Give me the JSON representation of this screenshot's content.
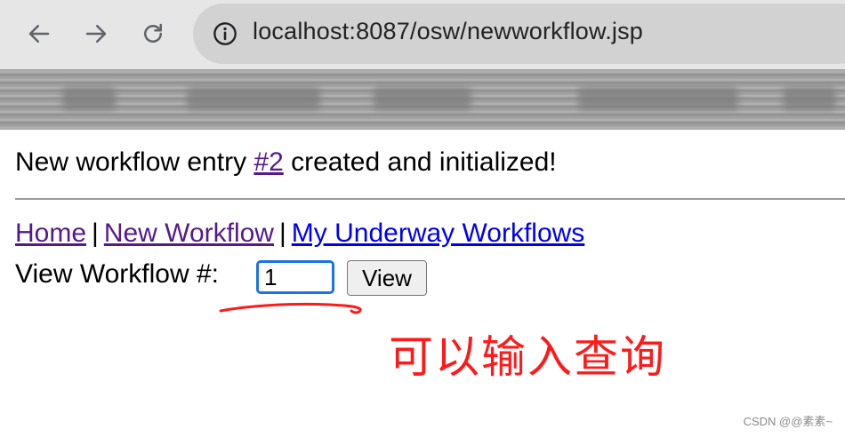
{
  "browser": {
    "url": "localhost:8087/osw/newworkflow.jsp",
    "icons": {
      "back": "arrow-left-icon",
      "forward": "arrow-right-icon",
      "reload": "reload-icon",
      "site_info": "info-icon"
    }
  },
  "page": {
    "message_prefix": "New workflow entry ",
    "entry_link": "#2",
    "message_suffix": " created and initialized!",
    "nav": {
      "home": "Home",
      "separator": "|",
      "new_workflow": "New Workflow",
      "my_underway": "My Underway Workflows"
    },
    "view_label": "View Workflow #:",
    "view_input_value": "1",
    "view_button": "View"
  },
  "annotation": {
    "text": "可以输入查询",
    "color": "#ff1a1a"
  },
  "watermark": "CSDN @@素素~",
  "colors": {
    "visited_link": "#551a8b",
    "unvisited_link": "#0000ee",
    "focus_ring": "#1a73e8"
  }
}
